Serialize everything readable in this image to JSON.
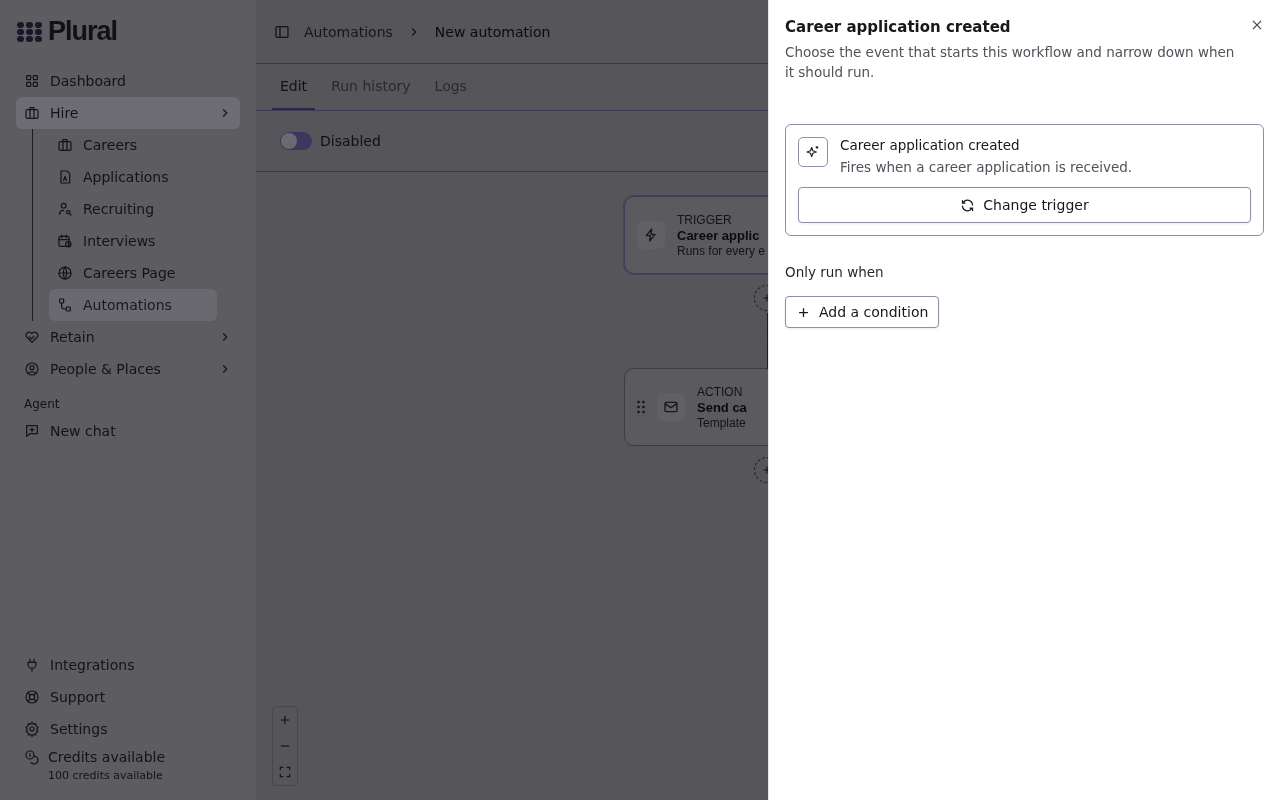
{
  "logo": {
    "text": "Plural"
  },
  "sidebar": {
    "items": [
      {
        "label": "Dashboard",
        "selected": false
      },
      {
        "label": "Hire",
        "selected": true,
        "children": [
          {
            "label": "Careers",
            "selected": false
          },
          {
            "label": "Applications",
            "selected": false
          },
          {
            "label": "Recruiting",
            "selected": false
          },
          {
            "label": "Interviews",
            "selected": false
          },
          {
            "label": "Careers Page",
            "selected": false
          },
          {
            "label": "Automations",
            "selected": true
          }
        ]
      },
      {
        "label": "Retain",
        "selected": false
      },
      {
        "label": "People & Places",
        "selected": false
      }
    ],
    "section_label": "Agent",
    "agent_items": [
      {
        "label": "New chat"
      }
    ],
    "footer_items": [
      {
        "label": "Integrations"
      },
      {
        "label": "Support"
      },
      {
        "label": "Settings"
      }
    ],
    "credits": {
      "label": "Credits available",
      "detail": "100 credits available"
    }
  },
  "breadcrumb": [
    "Automations",
    "New automation"
  ],
  "tabs": [
    {
      "label": "Edit",
      "selected": true
    },
    {
      "label": "Run history",
      "selected": false
    },
    {
      "label": "Logs",
      "selected": false
    }
  ],
  "toggle": {
    "label": "Disabled",
    "on": false
  },
  "canvas": {
    "nodes": [
      {
        "kind": "trigger",
        "type_label": "TRIGGER",
        "title": "Career applic",
        "subtitle": "Runs for every e"
      },
      {
        "kind": "action",
        "type_label": "ACTION",
        "title": "Send ca",
        "subtitle": "Template"
      }
    ]
  },
  "drawer": {
    "title": "Career application created",
    "description": "Choose the event that starts this workflow and narrow down when it should run.",
    "trigger": {
      "title": "Career application created",
      "description": "Fires when a career application is received.",
      "button": "Change trigger"
    },
    "conditions_label": "Only run when",
    "add_button": "Add a condition"
  }
}
